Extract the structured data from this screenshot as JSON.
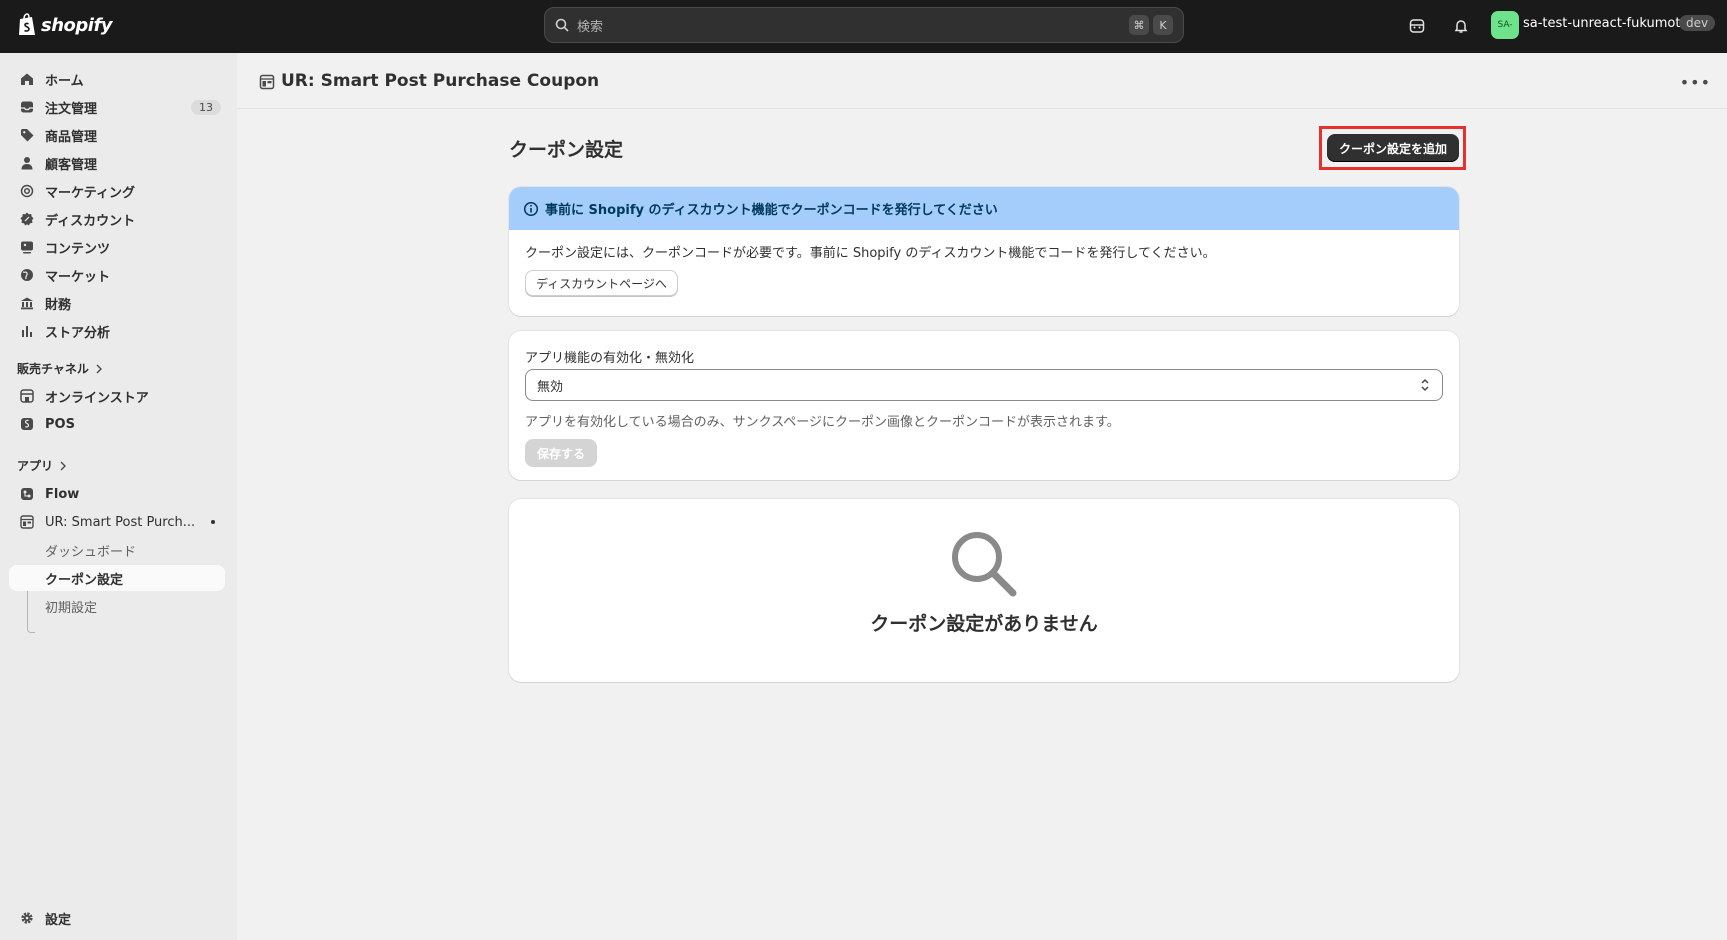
{
  "topbar": {
    "logo_text": "shopify",
    "search_placeholder": "検索",
    "shortcut_key1": "⌘",
    "shortcut_key2": "K",
    "avatar_initials": "SA-",
    "store_name": "sa-test-unreact-fukumoto",
    "store_badge": "dev"
  },
  "sidebar": {
    "items": [
      {
        "label": "ホーム"
      },
      {
        "label": "注文管理",
        "count": "13"
      },
      {
        "label": "商品管理"
      },
      {
        "label": "顧客管理"
      },
      {
        "label": "マーケティング"
      },
      {
        "label": "ディスカウント"
      },
      {
        "label": "コンテンツ"
      },
      {
        "label": "マーケット"
      },
      {
        "label": "財務"
      },
      {
        "label": "ストア分析"
      }
    ],
    "sales_channels_heading": "販売チャネル",
    "sales_channels": [
      {
        "label": "オンラインストア"
      },
      {
        "label": "POS"
      }
    ],
    "apps_heading": "アプリ",
    "apps": [
      {
        "label": "Flow"
      },
      {
        "label": "UR: Smart Post Purch..."
      }
    ],
    "app_subitems": [
      {
        "label": "ダッシュボード"
      },
      {
        "label": "クーポン設定"
      },
      {
        "label": "初期設定"
      }
    ],
    "settings_label": "設定"
  },
  "page": {
    "title": "UR: Smart Post Purchase Coupon",
    "section_title": "クーポン設定",
    "add_button": "クーポン設定を追加",
    "banner": {
      "title": "事前に Shopify のディスカウント機能でクーポンコードを発行してください",
      "body": "クーポン設定には、クーポンコードが必要です。事前に Shopify のディスカウント機能でコードを発行してください。",
      "button": "ディスカウントページへ"
    },
    "toggle_card": {
      "label": "アプリ機能の有効化・無効化",
      "selected": "無効",
      "help": "アプリを有効化している場合のみ、サンクスページにクーポン画像とクーポンコードが表示されます。",
      "save_button": "保存する"
    },
    "empty_state": {
      "text": "クーポン設定がありません"
    }
  },
  "colors": {
    "topbar_bg": "#1a1a1a",
    "banner_bg": "#a4cdfc",
    "highlight": "#e5322d",
    "primary_button": "#303030"
  }
}
